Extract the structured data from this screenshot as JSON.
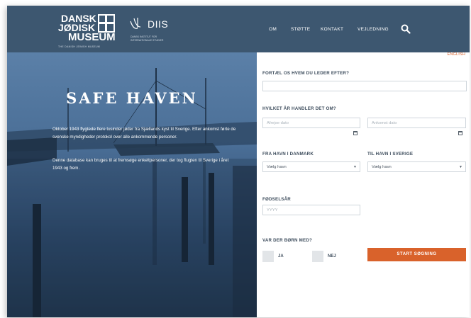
{
  "header": {
    "logo_line1": "DANSK",
    "logo_line2": "JØDISK",
    "logo_line3": "MUSEUM",
    "logo_tagline": "THE DANISH JEWISH MUSEUM",
    "diis_name": "DIIS",
    "diis_sub": "DANSK INSTITUT FOR INTERNATIONALE STUDIER",
    "nav": [
      "OM",
      "STØTTE",
      "KONTAKT",
      "VEJLEDNING"
    ],
    "background": "#3d5770"
  },
  "hero": {
    "title": "SAFE HAVEN",
    "paragraph1": "Oktober 1943 flygtede flere tusinder jøder fra Sjællands kyst til Sverige. Efter ankomst førte de svenske myndigheder protokol over alle ankommende personer.",
    "paragraph2": "Denne database kan bruges til at fremsøge enkeltpersoner, der tog flugten til Sverige i året 1943 og frem."
  },
  "form": {
    "language_link": "ENGLISH",
    "q_who_label": "FORTÆL OS HVEM DU LEDER EFTER?",
    "q_when_label": "HVILKET ÅR HANDLER DET OM?",
    "departure_placeholder": "Afrejse dato",
    "arrival_placeholder": "Ankomst dato",
    "from_port_label": "FRA HAVN I DANMARK",
    "to_port_label": "TIL HAVN I SVERIGE",
    "from_port_value": "Vælg havn",
    "to_port_value": "Vælg havn",
    "birth_year_label": "FØDSELSÅR",
    "birth_year_placeholder": "YYYY",
    "children_label": "VAR DER BØRN MED?",
    "yes_label": "JA",
    "no_label": "NEJ",
    "start_button": "START SØGNING",
    "accent": "#d9622b"
  }
}
